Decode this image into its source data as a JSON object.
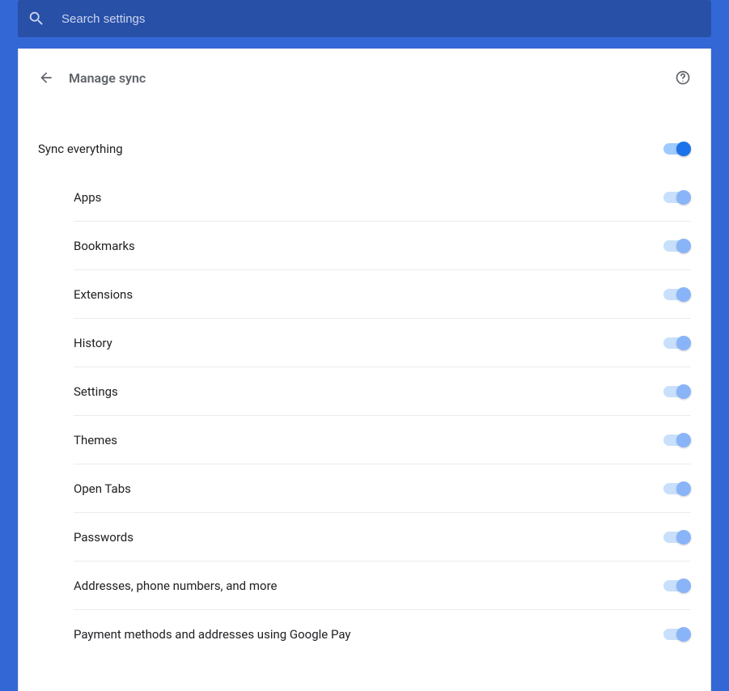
{
  "search": {
    "placeholder": "Search settings"
  },
  "header": {
    "title": "Manage sync"
  },
  "master": {
    "label": "Sync everything",
    "state": "on"
  },
  "items": [
    {
      "label": "Apps",
      "state": "on-disabled"
    },
    {
      "label": "Bookmarks",
      "state": "on-disabled"
    },
    {
      "label": "Extensions",
      "state": "on-disabled"
    },
    {
      "label": "History",
      "state": "on-disabled"
    },
    {
      "label": "Settings",
      "state": "on-disabled"
    },
    {
      "label": "Themes",
      "state": "on-disabled"
    },
    {
      "label": "Open Tabs",
      "state": "on-disabled"
    },
    {
      "label": "Passwords",
      "state": "on-disabled"
    },
    {
      "label": "Addresses, phone numbers, and more",
      "state": "on-disabled"
    },
    {
      "label": "Payment methods and addresses using Google Pay",
      "state": "on-disabled"
    }
  ]
}
